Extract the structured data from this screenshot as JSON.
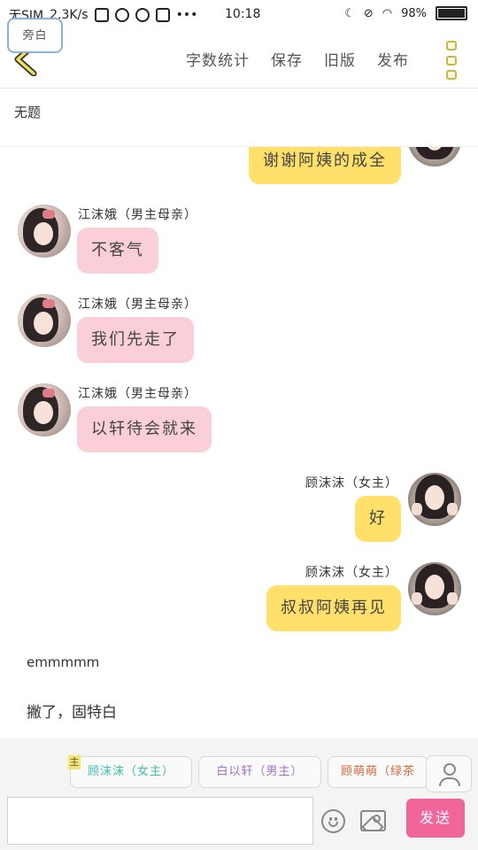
{
  "status_bar": {
    "carrier": "无SIM",
    "speed": "2.3K/s",
    "time": "10:18",
    "battery": "98%",
    "dots": "•••"
  },
  "toolbar": {
    "actions": [
      "字数统计",
      "保存",
      "旧版",
      "发布"
    ],
    "accent": "#c9b64a"
  },
  "title": "无题",
  "messages": [
    {
      "side": "right",
      "name": "",
      "text": "谢谢阿姨的成全",
      "color": "#ffe06a"
    },
    {
      "side": "left",
      "name": "江沫娥（男主母亲）",
      "text": "不客气",
      "color": "#fbcfd7"
    },
    {
      "side": "left",
      "name": "江沫娥（男主母亲）",
      "text": "我们先走了",
      "color": "#fbcfd7"
    },
    {
      "side": "left",
      "name": "江沫娥（男主母亲）",
      "text": "以轩待会就来",
      "color": "#fbcfd7"
    },
    {
      "side": "right",
      "name": "顾沫沫（女主）",
      "text": "好",
      "color": "#ffe06a"
    },
    {
      "side": "right",
      "name": "顾沫沫（女主）",
      "text": "叔叔阿姨再见",
      "color": "#ffe06a"
    }
  ],
  "narration": [
    "emmmmm",
    "撇了，固特白"
  ],
  "roles": {
    "narrator": "旁白",
    "lead_badge": "主",
    "items": [
      {
        "label": "顾沫沫（女主）",
        "color": "#3fbfae"
      },
      {
        "label": "白以轩（男主）",
        "color": "#a070c8"
      },
      {
        "label": "顾萌萌（绿茶",
        "color": "#d9673b"
      }
    ]
  },
  "input": {
    "placeholder": "",
    "send_label": "发送",
    "send_color": "#f0669a"
  }
}
